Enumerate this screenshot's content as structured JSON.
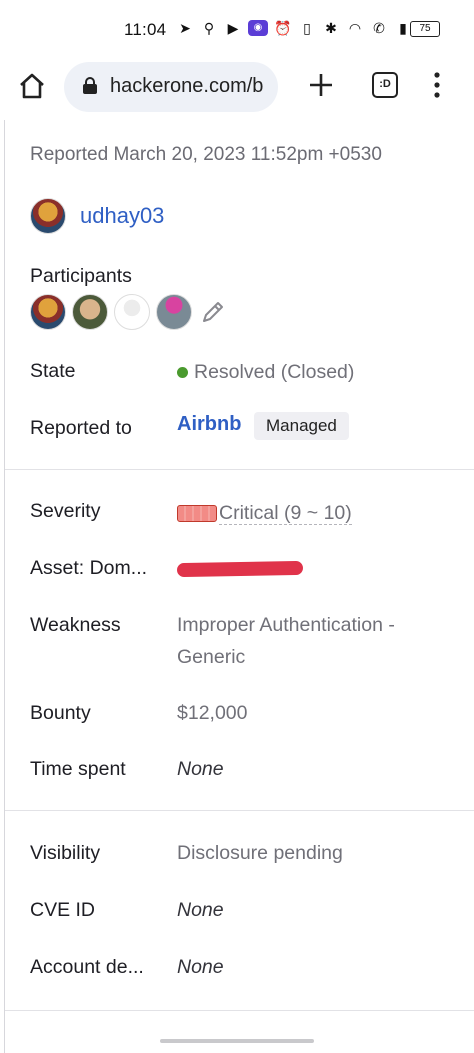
{
  "status_bar": {
    "time": "11:04",
    "battery": "75"
  },
  "browser": {
    "url": "hackerone.com/b",
    "tabs_label": ":D"
  },
  "report": {
    "reported_line": "Reported March 20, 2023 11:52pm +0530",
    "reporter": "udhay03",
    "participants_label": "Participants",
    "state_label": "State",
    "state_value": "Resolved (Closed)",
    "reported_to_label": "Reported to",
    "program": "Airbnb",
    "program_badge": "Managed"
  },
  "details": {
    "severity_label": "Severity",
    "severity_value": "Critical (9 ~ 10)",
    "asset_label": "Asset: Dom...",
    "weakness_label": "Weakness",
    "weakness_value_line1": "Improper Authentication -",
    "weakness_value_line2": "Generic",
    "bounty_label": "Bounty",
    "bounty_value": "$12,000",
    "time_spent_label": "Time spent",
    "time_spent_value": "None"
  },
  "disclosure": {
    "visibility_label": "Visibility",
    "visibility_value": "Disclosure pending",
    "cve_label": "CVE ID",
    "cve_value": "None",
    "account_label": "Account de...",
    "account_value": "None"
  },
  "colors": {
    "link_blue": "#2f5fc4",
    "resolved_green": "#4a9a2e",
    "critical_red": "#c0392b"
  }
}
